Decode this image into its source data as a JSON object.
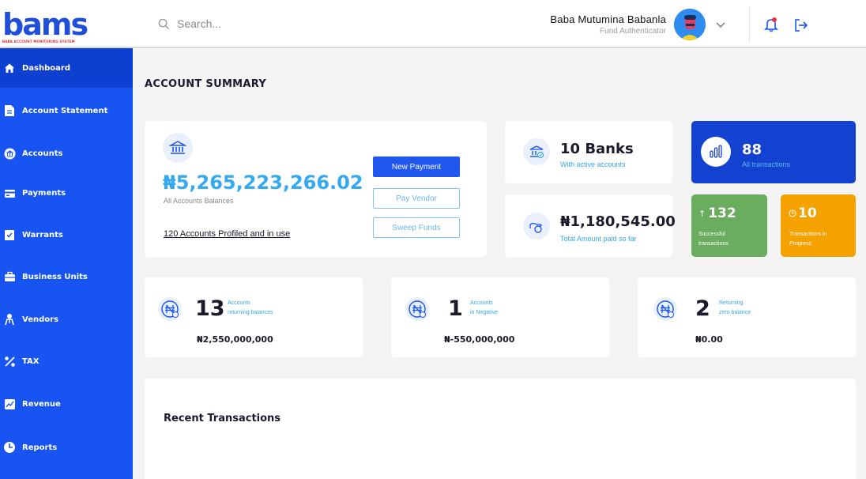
{
  "brand": {
    "name": "bams",
    "tagline": "BABA ACCOUNT MONITORING SYSTEM"
  },
  "search": {
    "placeholder": "Search..."
  },
  "user": {
    "name": "Baba Mutumina  Babanla",
    "role": "Fund Authenticator"
  },
  "sidebar": {
    "items": [
      {
        "label": "Dashboard",
        "icon": "home-icon",
        "active": true
      },
      {
        "label": "Account Statement",
        "icon": "document-icon"
      },
      {
        "label": "Accounts",
        "icon": "accounts-icon"
      },
      {
        "label": "Payments",
        "icon": "payments-icon"
      },
      {
        "label": "Warrants",
        "icon": "warrant-icon"
      },
      {
        "label": "Business Units",
        "icon": "briefcase-icon"
      },
      {
        "label": "Vendors",
        "icon": "vendor-icon"
      },
      {
        "label": "TAX",
        "icon": "percent-icon"
      },
      {
        "label": "Revenue",
        "icon": "revenue-icon"
      },
      {
        "label": "Reports",
        "icon": "reports-icon"
      }
    ]
  },
  "page": {
    "title": "ACCOUNT SUMMARY"
  },
  "balance_card": {
    "amount": "₦5,265,223,266.02",
    "caption": "All Accounts Balances",
    "profiled_link": "120 Accounts Profiled and in use",
    "buttons": {
      "new_payment": "New Payment",
      "pay_vendor": "Pay Vendor",
      "sweep_funds": "Sweep Funds"
    }
  },
  "banks_card": {
    "value": "10 Banks",
    "caption": "With active accounts"
  },
  "paid_card": {
    "value": "₦1,180,545.00",
    "caption": "Total Amount paid so far"
  },
  "transactions_card": {
    "value": "88",
    "caption": "All transactions"
  },
  "successful_card": {
    "value": "132",
    "caption": "Successful transactions",
    "color": "#6aad5e"
  },
  "progress_card": {
    "value": "10",
    "caption": "Transactions in Progress",
    "color": "#f5a100"
  },
  "account_stats": [
    {
      "count": "13",
      "label_line1": "Accounts",
      "label_line2": "returning balances",
      "amount": "₦2,550,000,000"
    },
    {
      "count": "1",
      "label_line1": "Accounts",
      "label_line2": "in Negative",
      "amount": "₦-550,000,000"
    },
    {
      "count": "2",
      "label_line1": "Returning",
      "label_line2": "zero balance",
      "amount": "₦0.00"
    }
  ],
  "recent": {
    "title": "Recent Transactions"
  },
  "colors": {
    "primary": "#1754f1",
    "accent": "#35a9f0",
    "dark_card": "#1442d0"
  }
}
